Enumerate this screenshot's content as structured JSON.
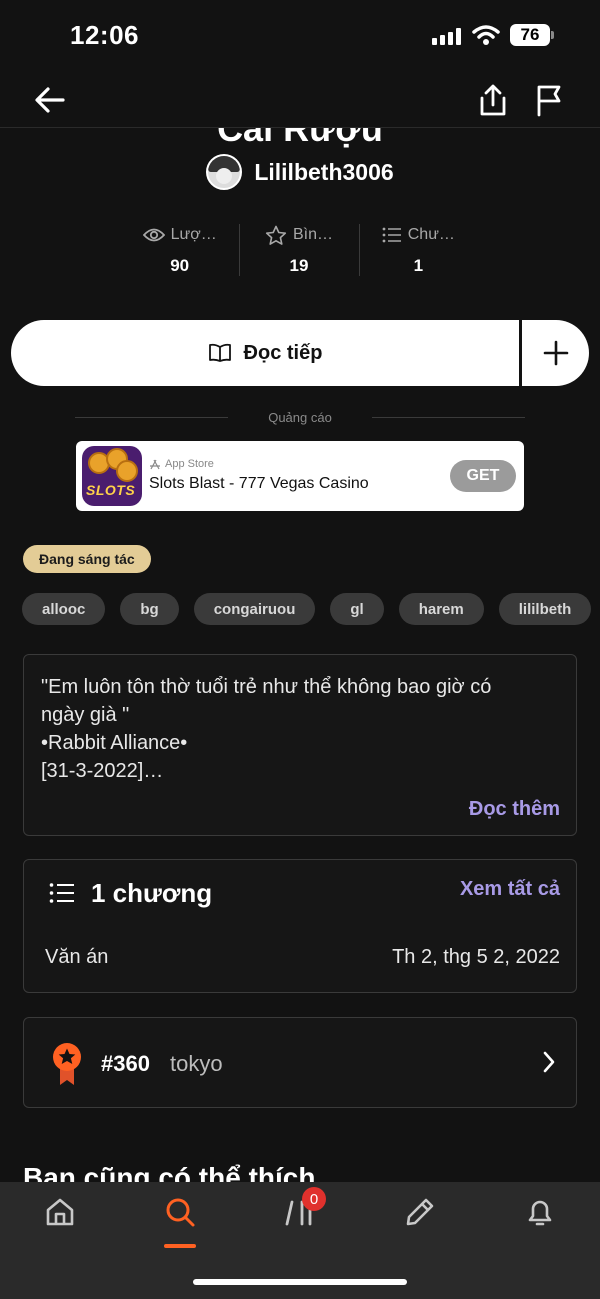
{
  "status_bar": {
    "time": "12:06",
    "battery": "76"
  },
  "story": {
    "title": "Cái Rượu",
    "author": "Lililbeth3006",
    "stats": [
      {
        "label": "Lượ…",
        "value": "90",
        "icon": "eye-icon"
      },
      {
        "label": "Bìn…",
        "value": "19",
        "icon": "star-icon"
      },
      {
        "label": "Chư…",
        "value": "1",
        "icon": "list-icon"
      }
    ]
  },
  "actions": {
    "read_label": "Đọc tiếp"
  },
  "ad": {
    "label": "Quảng cáo",
    "store": "App Store",
    "name": "Slots Blast - 777 Vegas Casino",
    "cta": "GET",
    "icon_text": "SLOTS"
  },
  "status_badge": "Đang sáng tác",
  "tags": [
    "allooc",
    "bg",
    "congairuou",
    "gl",
    "harem",
    "lililbeth"
  ],
  "description": {
    "text": "\"Em luôn tôn thờ tuổi trẻ như thể không bao giờ có\nngày già \"\n•Rabbit Alliance•\n[31-3-2022]…",
    "more": "Đọc thêm"
  },
  "chapters": {
    "count": "1 chương",
    "see_all": "Xem tất cả",
    "items": [
      {
        "title": "Văn án",
        "date": "Th 2, thg 5 2, 2022"
      }
    ]
  },
  "ranking": {
    "number": "#360",
    "tag": "tokyo"
  },
  "recommend_title": "Bạn cũng có thể thích",
  "tab_bar": {
    "notif_count": "0"
  },
  "colors": {
    "accent": "#ff6122",
    "link": "#a89ae6",
    "badge": "#e3cc96",
    "background": "#121212"
  }
}
